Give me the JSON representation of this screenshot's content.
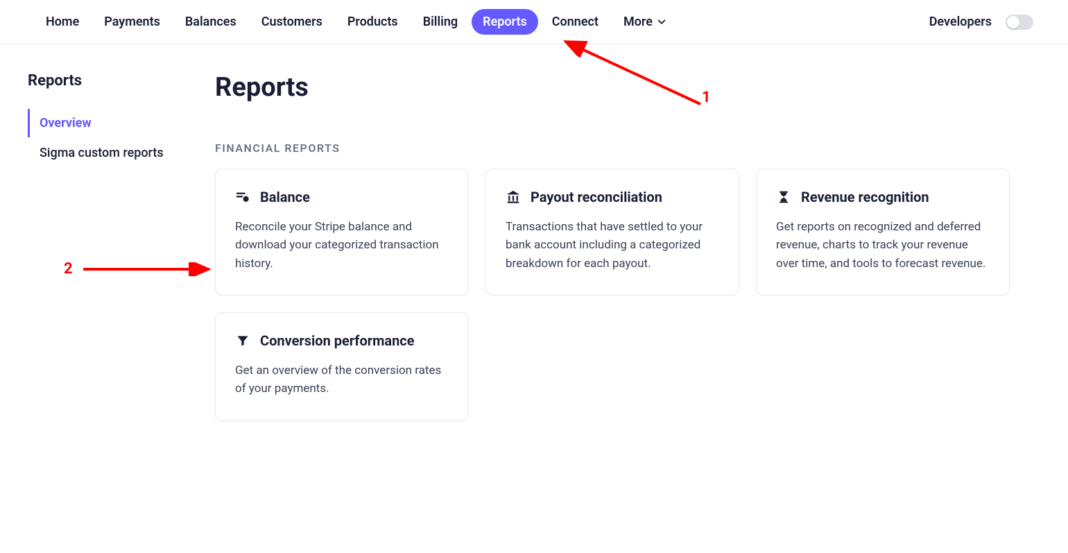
{
  "nav": {
    "items": [
      {
        "label": "Home"
      },
      {
        "label": "Payments"
      },
      {
        "label": "Balances"
      },
      {
        "label": "Customers"
      },
      {
        "label": "Products"
      },
      {
        "label": "Billing"
      },
      {
        "label": "Reports",
        "active": true
      },
      {
        "label": "Connect"
      },
      {
        "label": "More"
      }
    ],
    "developers": "Developers"
  },
  "sidebar": {
    "title": "Reports",
    "items": [
      {
        "label": "Overview",
        "active": true
      },
      {
        "label": "Sigma custom reports"
      }
    ]
  },
  "main": {
    "title": "Reports",
    "section_label": "FINANCIAL REPORTS",
    "cards": [
      {
        "icon": "balance-icon",
        "title": "Balance",
        "desc": "Reconcile your Stripe balance and download your categorized transaction history."
      },
      {
        "icon": "bank-icon",
        "title": "Payout reconciliation",
        "desc": "Transactions that have settled to your bank account including a categorized breakdown for each payout."
      },
      {
        "icon": "hourglass-icon",
        "title": "Revenue recognition",
        "desc": "Get reports on recognized and deferred revenue, charts to track your revenue over time, and tools to forecast revenue."
      },
      {
        "icon": "funnel-icon",
        "title": "Conversion performance",
        "desc": "Get an overview of the conversion rates of your payments."
      }
    ]
  },
  "annotations": {
    "label1": "1",
    "label2": "2"
  }
}
